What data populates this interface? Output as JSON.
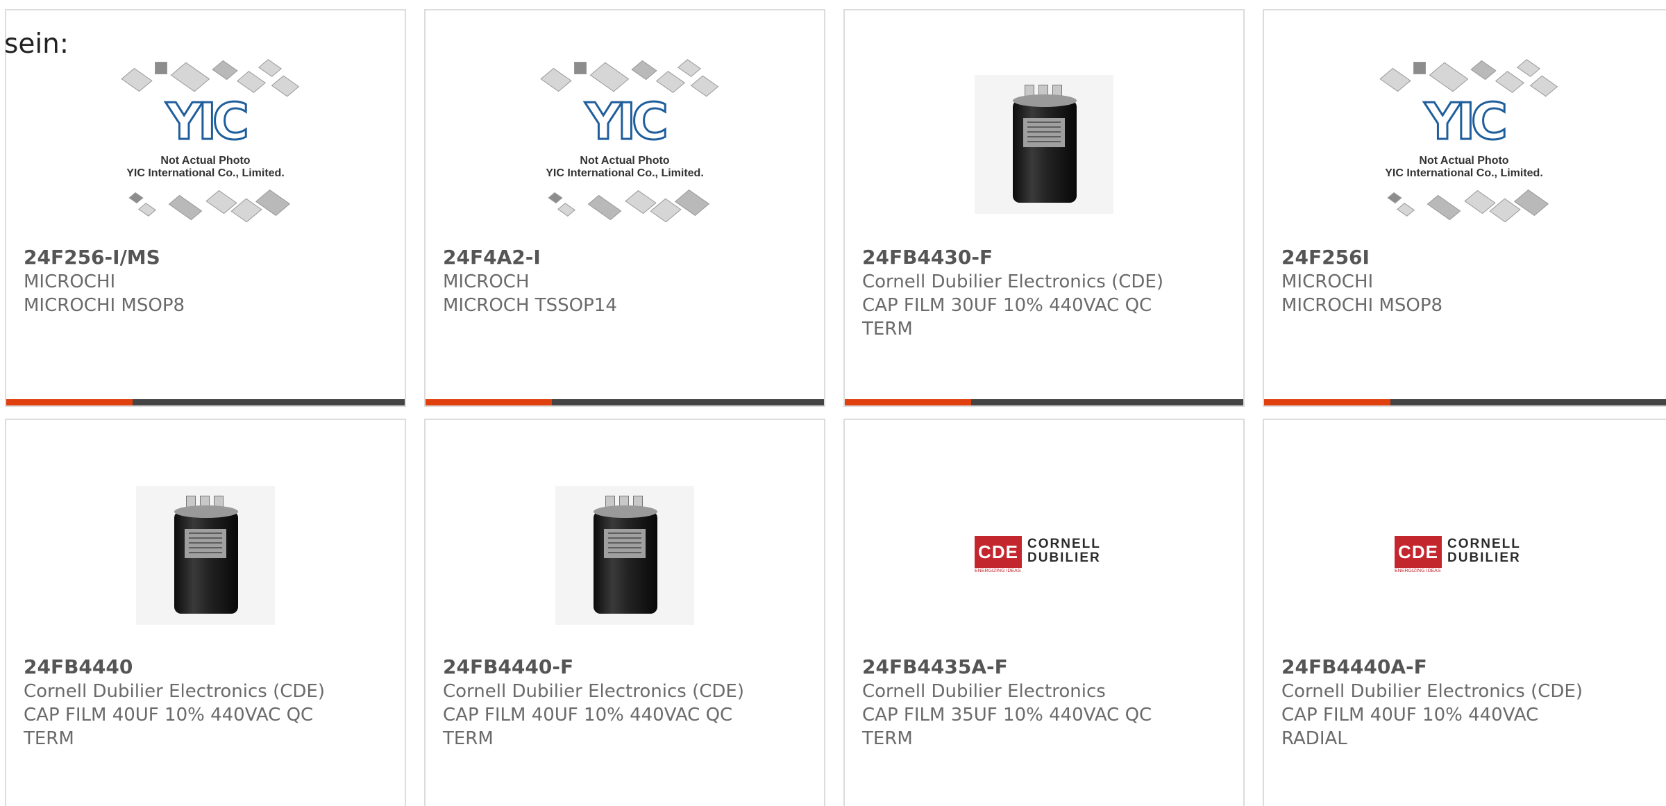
{
  "lead_text": "sein:",
  "placeholder_caption": {
    "logo_text": "YIC",
    "line1": "Not Actual Photo",
    "line2": "YIC International Co., Limited."
  },
  "cde_logo": {
    "mark": "CDE",
    "name_line1": "CORNELL",
    "name_line2": "DUBILIER",
    "tagline": "ENERGIZING IDEAS"
  },
  "accent_color": "#e0400e",
  "products": [
    {
      "part": "24F256-I/MS",
      "manufacturer": "MICROCHI",
      "description": "MICROCHI MSOP8",
      "image": "yic-placeholder"
    },
    {
      "part": "24F4A2-I",
      "manufacturer": "MICROCH",
      "description": "MICROCH TSSOP14",
      "image": "yic-placeholder"
    },
    {
      "part": "24FB4430-F",
      "manufacturer": "Cornell Dubilier Electronics (CDE)",
      "description": "CAP FILM 30UF 10% 440VAC QC TERM",
      "image": "capacitor-photo"
    },
    {
      "part": "24F256I",
      "manufacturer": "MICROCHI",
      "description": "MICROCHI MSOP8",
      "image": "yic-placeholder"
    },
    {
      "part": "24FB4440",
      "manufacturer": "Cornell Dubilier Electronics (CDE)",
      "description": "CAP FILM 40UF 10% 440VAC QC TERM",
      "image": "capacitor-photo"
    },
    {
      "part": "24FB4440-F",
      "manufacturer": "Cornell Dubilier Electronics (CDE)",
      "description": "CAP FILM 40UF 10% 440VAC QC TERM",
      "image": "capacitor-photo"
    },
    {
      "part": "24FB4435A-F",
      "manufacturer": "Cornell Dubilier Electronics",
      "description": "CAP FILM 35UF 10% 440VAC QC TERM",
      "image": "cde-logo"
    },
    {
      "part": "24FB4440A-F",
      "manufacturer": "Cornell Dubilier Electronics (CDE)",
      "description": "CAP FILM 40UF 10% 440VAC RADIAL",
      "image": "cde-logo"
    }
  ]
}
